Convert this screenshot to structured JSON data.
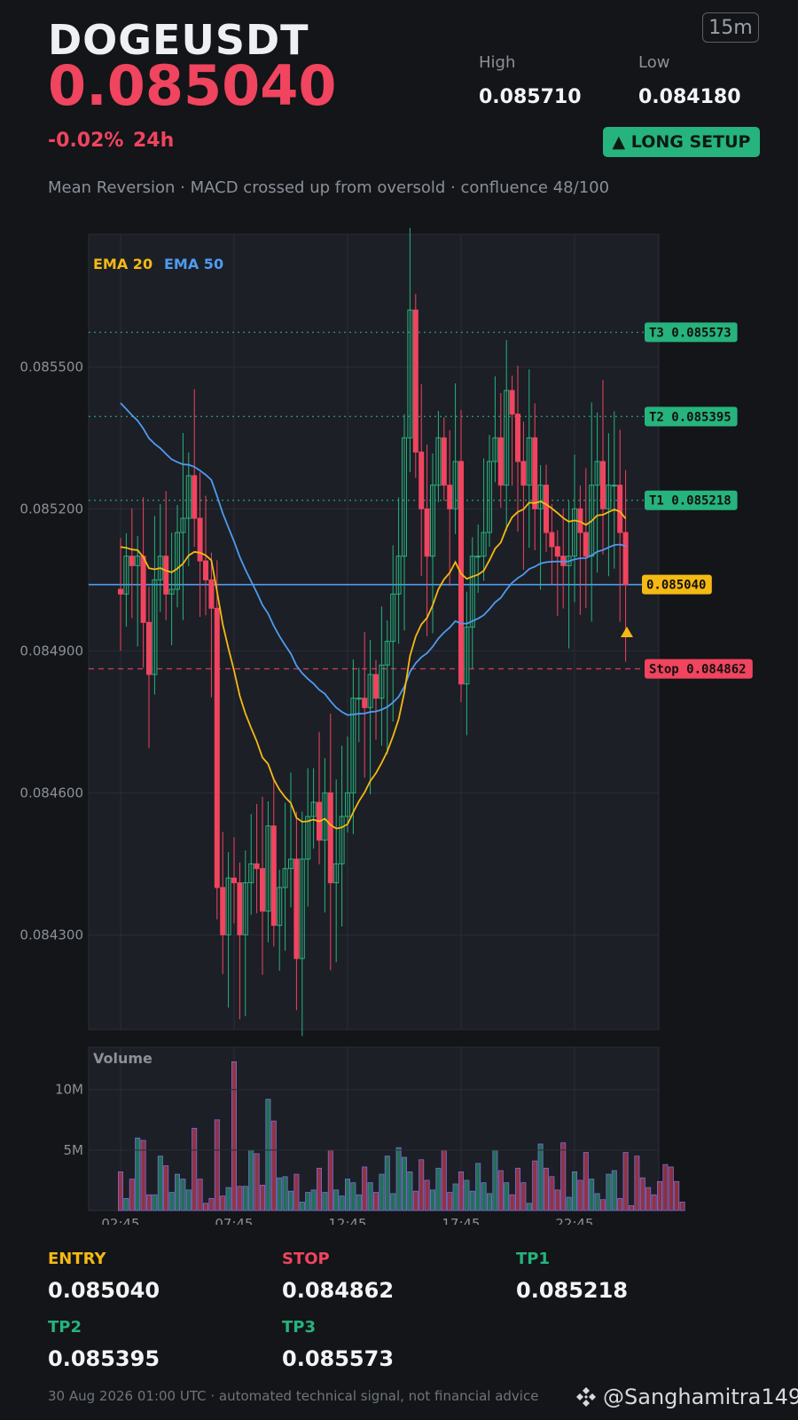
{
  "header": {
    "symbol": "DOGEUSDT",
    "price": "0.085040",
    "change": "-0.02%",
    "period": "24h",
    "timeframe": "15m",
    "high_label": "High",
    "high_value": "0.085710",
    "low_label": "Low",
    "low_value": "0.084180",
    "setup_badge": "▲ LONG SETUP",
    "description": "Mean Reversion · MACD crossed up from oversold · confluence 48/100"
  },
  "levels": {
    "entry_label": "ENTRY",
    "entry_value": "0.085040",
    "stop_label": "STOP",
    "stop_value": "0.084862",
    "tp1_label": "TP1",
    "tp1_value": "0.085218",
    "tp2_label": "TP2",
    "tp2_value": "0.085395",
    "tp3_label": "TP3",
    "tp3_value": "0.085573"
  },
  "footer": {
    "note": "30 Aug 2026 01:00 UTC  ·  automated technical signal, not financial advice",
    "brand": "@Sanghamitra149"
  },
  "colors": {
    "up": "#26b37d",
    "down": "#f0445f",
    "ema20": "#f5b914",
    "ema50": "#4f9bf0",
    "background": "#131518",
    "panel": "#1c1f26"
  },
  "chart_data": [
    {
      "type": "candlestick",
      "title": "",
      "legend": [
        "EMA 20",
        "EMA 50"
      ],
      "y_ticks": [
        0.0843,
        0.0846,
        0.0849,
        0.0852,
        0.0855
      ],
      "y_tick_labels": [
        "0.084300",
        "0.084600",
        "0.084900",
        "0.085200",
        "0.085500"
      ],
      "ylim": [
        0.0841,
        0.08578
      ],
      "x_tick_labels": [
        "02:45",
        "07:45",
        "12:45",
        "17:45",
        "22:45"
      ],
      "x_tick_index": [
        0,
        20,
        40,
        60,
        80
      ],
      "level_lines": [
        {
          "label": "T3 0.085573",
          "value": 0.085573,
          "color": "#26b37d",
          "style": "dotted"
        },
        {
          "label": "T2 0.085395",
          "value": 0.085395,
          "color": "#26b37d",
          "style": "dotted"
        },
        {
          "label": "T1 0.085218",
          "value": 0.085218,
          "color": "#26b37d",
          "style": "dotted"
        },
        {
          "label": "0.085040",
          "value": 0.08504,
          "color": "#4f9bf0",
          "style": "solid",
          "tag_color": "#f5b914"
        },
        {
          "label": "Stop 0.084862",
          "value": 0.084862,
          "color": "#f0445f",
          "style": "dashed"
        }
      ],
      "candles_close": [
        0.08502,
        0.0851,
        0.08508,
        0.0851,
        0.08496,
        0.08485,
        0.08505,
        0.0851,
        0.08502,
        0.08503,
        0.08515,
        0.08518,
        0.08527,
        0.08518,
        0.08509,
        0.08505,
        0.08499,
        0.0844,
        0.0843,
        0.08442,
        0.08441,
        0.0843,
        0.08441,
        0.08445,
        0.08444,
        0.08435,
        0.08453,
        0.08432,
        0.0844,
        0.08444,
        0.08446,
        0.08425,
        0.08446,
        0.08455,
        0.08458,
        0.0845,
        0.0846,
        0.08441,
        0.08445,
        0.08455,
        0.0846,
        0.0848,
        0.0848,
        0.08478,
        0.08485,
        0.0848,
        0.08487,
        0.08492,
        0.08502,
        0.0851,
        0.08535,
        0.08562,
        0.08532,
        0.0852,
        0.0851,
        0.08525,
        0.08535,
        0.08525,
        0.0852,
        0.0853,
        0.08483,
        0.08495,
        0.0851,
        0.0851,
        0.08515,
        0.0853,
        0.08535,
        0.08525,
        0.08545,
        0.0854,
        0.0853,
        0.08525,
        0.08535,
        0.0852,
        0.08525,
        0.08515,
        0.08512,
        0.0851,
        0.08508,
        0.0851,
        0.0852,
        0.08515,
        0.0851,
        0.08525,
        0.0853,
        0.0852,
        0.08525,
        0.08525,
        0.08515,
        0.08504
      ],
      "ema20_start": 0.08513,
      "ema50_start": 0.08544
    },
    {
      "type": "bar",
      "title": "Volume",
      "y_ticks": [
        5,
        10
      ],
      "y_tick_labels": [
        "5M",
        "10M"
      ],
      "ylim": [
        0,
        13.5
      ],
      "unit": "M",
      "values": [
        3.2,
        1.0,
        2.6,
        6.0,
        5.8,
        1.3,
        1.3,
        4.5,
        3.7,
        1.5,
        3.0,
        2.6,
        1.7,
        6.8,
        2.6,
        0.6,
        1.0,
        7.5,
        1.2,
        1.9,
        12.3,
        2.0,
        2.0,
        5.0,
        4.7,
        2.1,
        9.2,
        7.4,
        2.7,
        2.8,
        1.6,
        3.0,
        0.7,
        1.5,
        1.7,
        3.5,
        1.5,
        5.0,
        1.7,
        1.2,
        2.6,
        2.3,
        1.3,
        3.6,
        2.3,
        1.5,
        3.0,
        4.5,
        1.4,
        5.2,
        4.4,
        3.2,
        1.6,
        4.2,
        2.5,
        1.7,
        3.5,
        5.0,
        1.5,
        2.2,
        3.2,
        2.5,
        1.6,
        3.9,
        2.3,
        1.4,
        5.0,
        3.3,
        2.3,
        1.3,
        3.5,
        2.3,
        0.6,
        4.1,
        5.5,
        3.5,
        2.8,
        1.7,
        5.6,
        1.1,
        3.2,
        2.5,
        4.8,
        2.6,
        1.4,
        0.9,
        3.0,
        3.3,
        1.0,
        4.8,
        0.4,
        4.5,
        2.7,
        1.9,
        1.3,
        2.4,
        3.8,
        3.6,
        2.4,
        0.7
      ]
    }
  ]
}
